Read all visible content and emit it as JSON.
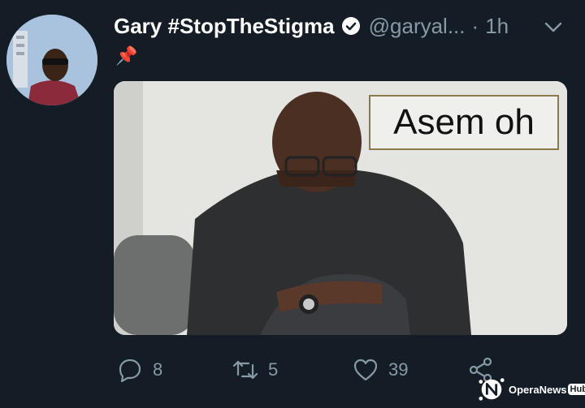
{
  "tweet": {
    "author_name": "Gary #StopTheStigma",
    "handle": "@garyal...",
    "separator": "·",
    "time": "1h",
    "text_emoji": "📌",
    "media_text": "Asem oh"
  },
  "actions": {
    "reply_count": "8",
    "retweet_count": "5",
    "like_count": "39"
  },
  "watermark": {
    "brand": "OperaNews",
    "hub": "Hub"
  },
  "colors": {
    "background": "#141d26",
    "muted": "#8899a6",
    "text": "#ffffff"
  }
}
